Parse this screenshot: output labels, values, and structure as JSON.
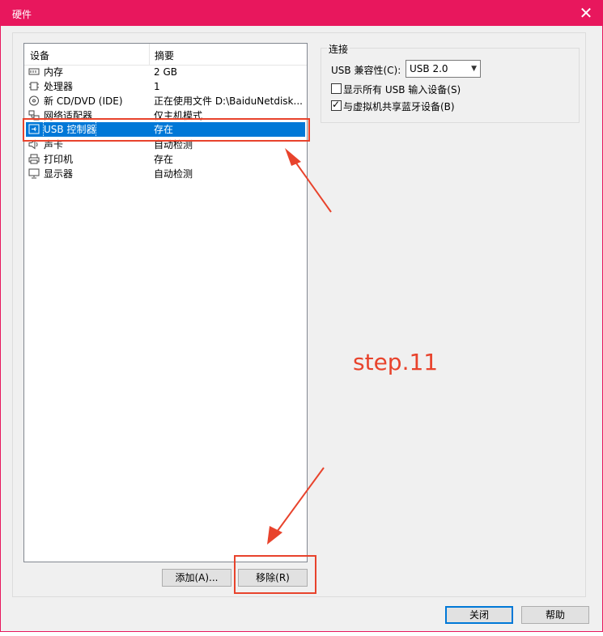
{
  "window": {
    "title": "硬件",
    "close_glyph": "✕"
  },
  "device_list": {
    "columns": [
      "设备",
      "摘要"
    ],
    "rows": [
      {
        "name": "内存",
        "summary": "2 GB",
        "icon": "memory-icon"
      },
      {
        "name": "处理器",
        "summary": "1",
        "icon": "processor-icon"
      },
      {
        "name": "新 CD/DVD (IDE)",
        "summary": "正在使用文件 D:\\BaiduNetdisk...",
        "icon": "cd-dvd-icon"
      },
      {
        "name": "网络适配器",
        "summary": "仅主机模式",
        "icon": "network-adapter-icon"
      },
      {
        "name": "USB 控制器",
        "summary": "存在",
        "icon": "usb-icon",
        "selected": true
      },
      {
        "name": "声卡",
        "summary": "自动检测",
        "icon": "sound-card-icon"
      },
      {
        "name": "打印机",
        "summary": "存在",
        "icon": "printer-icon"
      },
      {
        "name": "显示器",
        "summary": "自动检测",
        "icon": "display-icon"
      }
    ]
  },
  "buttons": {
    "add": "添加(A)...",
    "remove": "移除(R)",
    "close": "关闭",
    "help": "帮助"
  },
  "connection": {
    "title": "连接",
    "usb_compat_label": "USB 兼容性(C):",
    "usb_compat_value": "USB 2.0",
    "show_all_usb": {
      "label": "显示所有 USB 输入设备(S)",
      "checked": false
    },
    "share_bluetooth": {
      "label": "与虚拟机共享蓝牙设备(B)",
      "checked": true
    }
  },
  "annotation": {
    "step_text": "step.11",
    "color": "#e8432c"
  },
  "colors": {
    "titlebar": "#e8175d",
    "selection": "#0078d7"
  }
}
